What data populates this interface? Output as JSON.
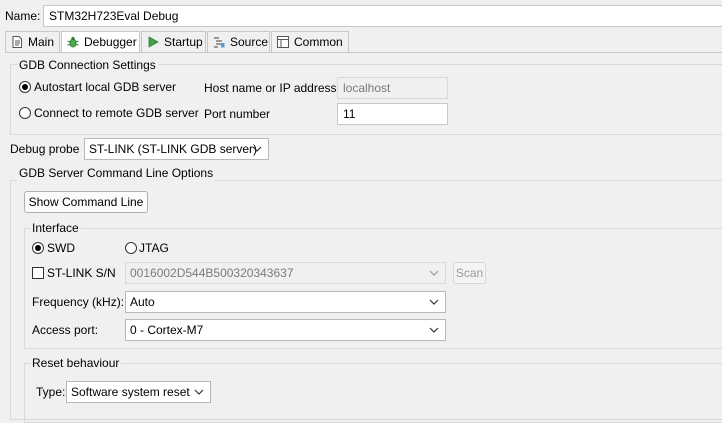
{
  "name": {
    "label": "Name:",
    "value": "STM32H723Eval Debug"
  },
  "tabs": [
    {
      "label": "Main",
      "icon": "document-icon",
      "active": false
    },
    {
      "label": "Debugger",
      "icon": "bug-icon",
      "active": true
    },
    {
      "label": "Startup",
      "icon": "play-icon",
      "active": false
    },
    {
      "label": "Source",
      "icon": "source-icon",
      "active": false
    },
    {
      "label": "Common",
      "icon": "common-icon",
      "active": false
    }
  ],
  "gdb_connection": {
    "title": "GDB Connection Settings",
    "autostart_label": "Autostart local GDB server",
    "remote_label": "Connect to remote GDB server",
    "selected": "autostart",
    "host_label": "Host name or IP address",
    "host_value": "localhost",
    "port_label": "Port number",
    "port_value": "11"
  },
  "debug_probe": {
    "label": "Debug probe",
    "value": "ST-LINK (ST-LINK GDB server)"
  },
  "gdb_server_options": {
    "title": "GDB Server Command Line Options",
    "show_command_line": "Show Command Line",
    "interface": {
      "title": "Interface",
      "swd_label": "SWD",
      "jtag_label": "JTAG",
      "selected": "SWD",
      "stlink_sn_label": "ST-LINK S/N",
      "stlink_sn_checked": false,
      "stlink_sn_value": "0016002D544B500320343637",
      "scan_label": "Scan",
      "frequency_label": "Frequency (kHz):",
      "frequency_value": "Auto",
      "access_port_label": "Access port:",
      "access_port_value": "0 - Cortex-M7"
    },
    "reset": {
      "title": "Reset behaviour",
      "type_label": "Type:",
      "type_value": "Software system reset"
    }
  },
  "colors": {
    "accent": "#2e7d32",
    "window": "#f0f0f0",
    "field": "#ffffff"
  }
}
